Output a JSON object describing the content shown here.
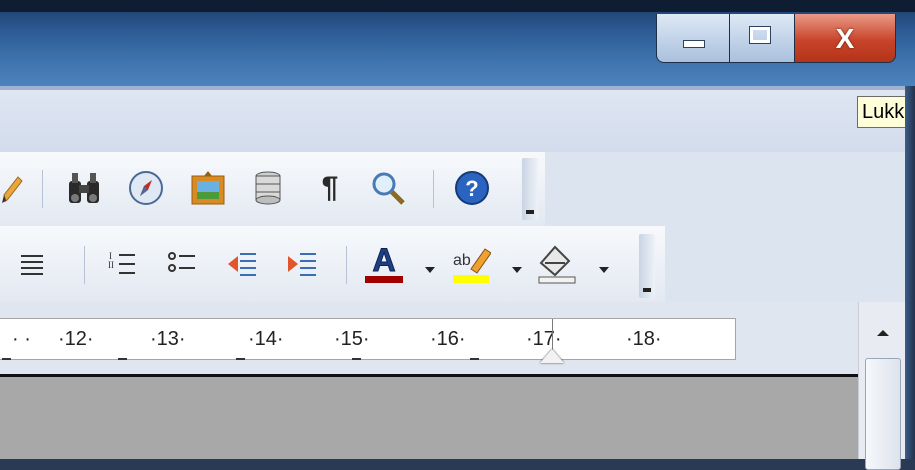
{
  "window": {
    "minimize_label": "",
    "maximize_label": "",
    "close_glyph": "X"
  },
  "tooltip": {
    "text": "Lukk"
  },
  "toolbar_standard": {
    "icons": [
      "draw-pencil-icon",
      "find-binoculars-icon",
      "navigator-icon",
      "gallery-icon",
      "data-sources-icon",
      "formatting-marks-icon",
      "zoom-icon",
      "help-icon"
    ]
  },
  "toolbar_formatting": {
    "icons": [
      "justify-icon",
      "numbering-icon",
      "bullets-icon",
      "decrease-indent-icon",
      "increase-indent-icon",
      "font-color-icon",
      "highlighting-icon",
      "background-color-icon"
    ],
    "font_color": "#a00000",
    "highlight_color": "#ffff00"
  },
  "ruler": {
    "labels": [
      "·12·",
      "·13·",
      "·14·",
      "·15·",
      "·16·",
      "·17·",
      "·18·"
    ]
  },
  "colors": {
    "titlebar": "#2c5a92",
    "close_button": "#c8442b",
    "document_bg": "#a8a8a8"
  }
}
